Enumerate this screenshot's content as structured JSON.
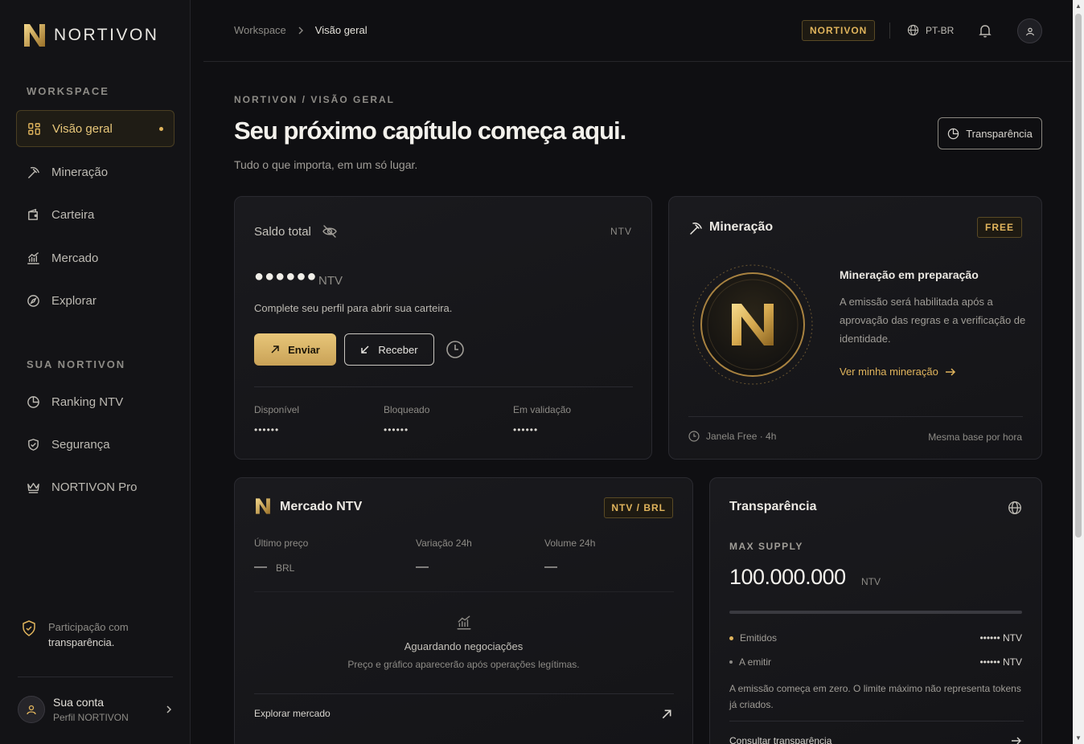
{
  "brand": {
    "name": "NORTIVON"
  },
  "sidebar": {
    "section_workspace": "WORKSPACE",
    "section_yours": "SUA NORTIVON",
    "items": [
      {
        "label": "Visão geral",
        "icon": "dashboard-icon",
        "active": true
      },
      {
        "label": "Mineração",
        "icon": "pickaxe-icon"
      },
      {
        "label": "Carteira",
        "icon": "wallet-icon"
      },
      {
        "label": "Mercado",
        "icon": "chart-icon"
      },
      {
        "label": "Explorar",
        "icon": "compass-icon"
      },
      {
        "label": "Ranking NTV",
        "icon": "pie-icon"
      },
      {
        "label": "Segurança",
        "icon": "shield-icon"
      },
      {
        "label": "NORTIVON Pro",
        "icon": "crown-icon"
      }
    ],
    "footer_note_1": "Participação com",
    "footer_note_2": "transparência.",
    "account_name": "Sua conta",
    "account_sub": "Perfil NORTIVON"
  },
  "topbar": {
    "breadcrumb_root": "Workspace",
    "breadcrumb_current": "Visão geral",
    "brand_badge": "NORTIVON",
    "language": "PT-BR"
  },
  "page": {
    "kicker": "NORTIVON / VISÃO GERAL",
    "headline": "Seu próximo capítulo começa aqui.",
    "subline": "Tudo o que importa, em um só lugar.",
    "transparency_button": "Transparência"
  },
  "balance_card": {
    "label": "Saldo total",
    "currency_tag": "NTV",
    "masked_balance": "●●●●●●",
    "unit": "NTV",
    "message": "Complete seu perfil para abrir sua carteira.",
    "send_label": "Enviar",
    "receive_label": "Receber",
    "stats": [
      {
        "label": "Disponível",
        "value": "••••••"
      },
      {
        "label": "Bloqueado",
        "value": "••••••"
      },
      {
        "label": "Em validação",
        "value": "••••••"
      }
    ]
  },
  "mining_card": {
    "title": "Mineração",
    "badge": "FREE",
    "heading": "Mineração em preparação",
    "description": "A emissão será habilitada após a aprovação das regras e a verificação de identidade.",
    "link": "Ver minha mineração",
    "footer_left": "Janela Free · 4h",
    "footer_right": "Mesma base por hora"
  },
  "market_card": {
    "title": "Mercado NTV",
    "pair": "NTV / BRL",
    "last_price_label": "Último preço",
    "last_price_value": "—",
    "last_price_unit": "BRL",
    "change_label": "Variação 24h",
    "change_value": "—",
    "volume_label": "Volume 24h",
    "volume_value": "—",
    "waiting_title": "Aguardando negociações",
    "waiting_sub": "Preço e gráfico aparecerão após operações legítimas.",
    "explore_link": "Explorar mercado"
  },
  "transparency_card": {
    "title": "Transparência",
    "max_supply_label": "MAX SUPPLY",
    "max_supply_value": "100.000.000",
    "max_supply_unit": "NTV",
    "issued_fraction": 0,
    "issued_label": "Emitidos",
    "issued_value": "•••••• NTV",
    "pending_label": "A emitir",
    "pending_value": "•••••• NTV",
    "note": "A emissão começa em zero. O limite máximo não representa tokens já criados.",
    "link": "Consultar transparência"
  },
  "colors": {
    "accent": "#e0b45c",
    "background": "#0f0f12",
    "card": "#18181c"
  }
}
